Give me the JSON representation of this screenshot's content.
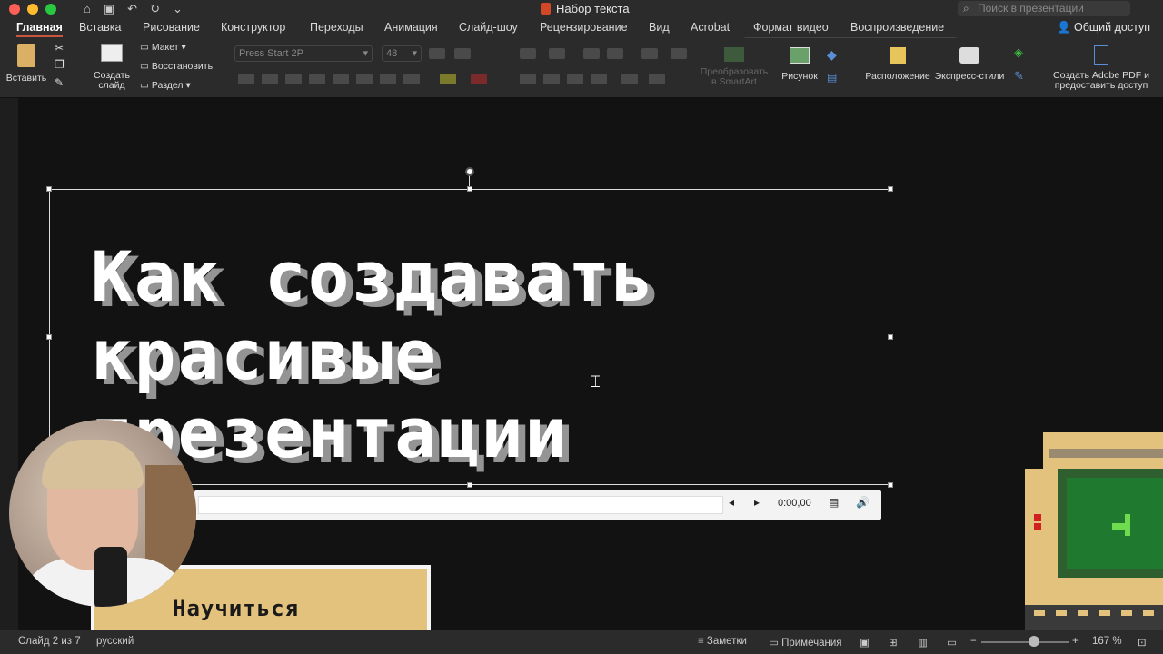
{
  "window": {
    "title": "Набор текста",
    "search_placeholder": "Поиск в презентации"
  },
  "ribbon": {
    "tabs": [
      "Главная",
      "Вставка",
      "Рисование",
      "Конструктор",
      "Переходы",
      "Анимация",
      "Слайд-шоу",
      "Рецензирование",
      "Вид",
      "Acrobat"
    ],
    "context_tabs": [
      "Формат видео",
      "Воспроизведение"
    ],
    "share_label": "Общий доступ"
  },
  "toolbar": {
    "paste_label": "Вставить",
    "new_slide_label": "Создать слайд",
    "layout_label": "Макет",
    "reset_label": "Восстановить",
    "section_label": "Раздел",
    "font_name": "Press Start 2P",
    "font_size": "48",
    "smartart_label": "Преобразовать в SmartArt",
    "picture_label": "Рисунок",
    "arrange_label": "Расположение",
    "quick_styles_label": "Экспресс-стили",
    "acrobat_label": "Создать Adobe PDF и предоставить доступ"
  },
  "slide": {
    "headline_lines": [
      "Как создавать",
      "красивые",
      "презентации"
    ],
    "cta_label": "Научиться",
    "player_time": "0:00,00"
  },
  "status": {
    "slide_counter": "Слайд 2 из 7",
    "language": "русский",
    "notes_label": "Заметки",
    "comments_label": "Примечания",
    "zoom": "167 %"
  },
  "colors": {
    "accent": "#c8553d",
    "cta_fill": "#e3c27d",
    "slide_bg": "#121212"
  }
}
